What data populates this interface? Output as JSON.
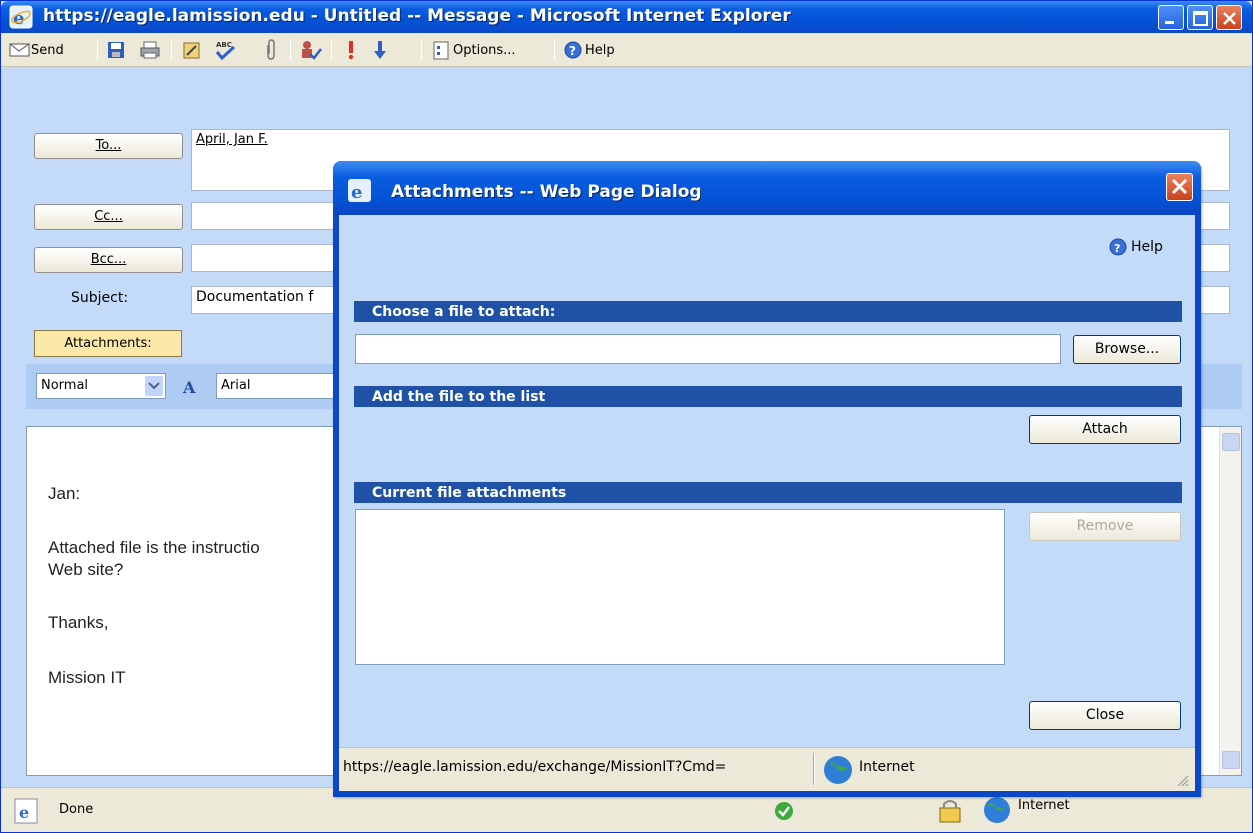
{
  "window": {
    "title": "https://eagle.lamission.edu - Untitled -- Message - Microsoft Internet Explorer"
  },
  "toolbar": {
    "send_label": "Send",
    "options_label": "Options...",
    "help_label": "Help",
    "icons": [
      "save-icon",
      "print-icon",
      "address-book-icon",
      "spell-check-icon",
      "paperclip-icon",
      "check-names-icon",
      "high-importance-icon",
      "low-importance-icon",
      "options-icon",
      "help-icon"
    ]
  },
  "compose": {
    "to_label": "To...",
    "to_value": "April, Jan F.",
    "cc_label": "Cc...",
    "cc_value": "",
    "bcc_label": "Bcc...",
    "bcc_value": "",
    "subject_label": "Subject:",
    "subject_value": "Documentation f",
    "attachments_label": "Attachments:",
    "style_value": "Normal",
    "font_value": "Arial",
    "body_lines": [
      "Jan:",
      "Attached file is the instructio",
      "Web site?",
      "Thanks,",
      "Mission IT"
    ]
  },
  "status": {
    "text": "Done",
    "zone": "Internet"
  },
  "dialog": {
    "title": "Attachments -- Web Page Dialog",
    "help_label": "Help",
    "section_choose": "Choose a file to attach:",
    "file_value": "",
    "browse_label": "Browse...",
    "section_add": "Add the file to the list",
    "attach_label": "Attach",
    "section_current": "Current file attachments",
    "remove_label": "Remove",
    "close_label": "Close",
    "status_url": "https://eagle.lamission.edu/exchange/MissionIT?Cmd=",
    "status_zone": "Internet"
  },
  "colors": {
    "titlebar_blue": "#0a5ce0",
    "section_bar": "#1f52a6",
    "compose_bg": "#c3daf9",
    "attachments_button": "#fbe7a8"
  }
}
